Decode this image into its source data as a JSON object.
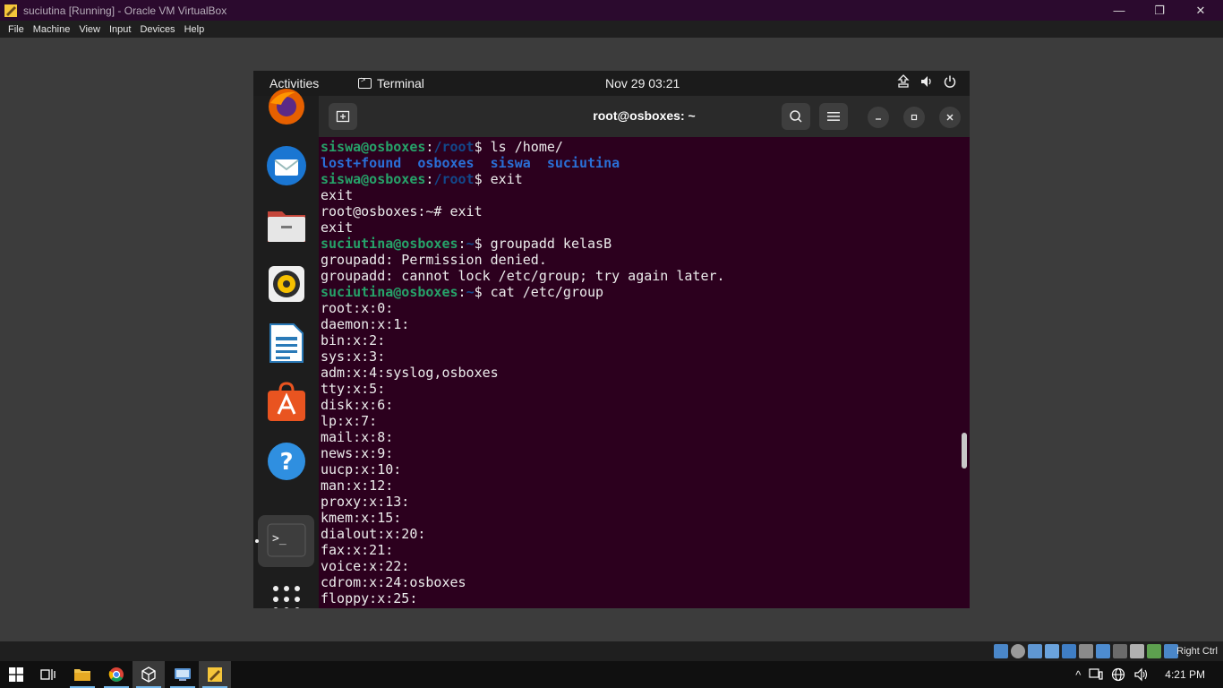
{
  "window": {
    "title": "suciutina [Running] - Oracle VM VirtualBox",
    "minimize_glyph": "—",
    "restore_glyph": "❐",
    "close_glyph": "✕"
  },
  "menubar": {
    "items": [
      "File",
      "Machine",
      "View",
      "Input",
      "Devices",
      "Help"
    ]
  },
  "guest_topbar": {
    "activities": "Activities",
    "app_name": "Terminal",
    "clock": "Nov 29  03:21"
  },
  "terminal": {
    "title": "root@osboxes: ~",
    "lines": [
      [
        {
          "t": "siswa@osboxes",
          "c": "user"
        },
        {
          "t": ":",
          "c": ""
        },
        {
          "t": "/root",
          "c": "path"
        },
        {
          "t": "$ ls /home/",
          "c": ""
        }
      ],
      [
        {
          "t": "lost+found  osboxes  siswa  suciutina",
          "c": "dir"
        }
      ],
      [
        {
          "t": "siswa@osboxes",
          "c": "user"
        },
        {
          "t": ":",
          "c": ""
        },
        {
          "t": "/root",
          "c": "path"
        },
        {
          "t": "$ exit",
          "c": ""
        }
      ],
      [
        {
          "t": "exit",
          "c": ""
        }
      ],
      [
        {
          "t": "root@osboxes:~# exit",
          "c": ""
        }
      ],
      [
        {
          "t": "exit",
          "c": ""
        }
      ],
      [
        {
          "t": "suciutina@osboxes",
          "c": "user"
        },
        {
          "t": ":",
          "c": ""
        },
        {
          "t": "~",
          "c": "path"
        },
        {
          "t": "$ groupadd kelasB",
          "c": ""
        }
      ],
      [
        {
          "t": "groupadd: Permission denied.",
          "c": ""
        }
      ],
      [
        {
          "t": "groupadd: cannot lock /etc/group; try again later.",
          "c": ""
        }
      ],
      [
        {
          "t": "suciutina@osboxes",
          "c": "user"
        },
        {
          "t": ":",
          "c": ""
        },
        {
          "t": "~",
          "c": "path"
        },
        {
          "t": "$ cat /etc/group",
          "c": ""
        }
      ],
      [
        {
          "t": "root:x:0:",
          "c": ""
        }
      ],
      [
        {
          "t": "daemon:x:1:",
          "c": ""
        }
      ],
      [
        {
          "t": "bin:x:2:",
          "c": ""
        }
      ],
      [
        {
          "t": "sys:x:3:",
          "c": ""
        }
      ],
      [
        {
          "t": "adm:x:4:syslog,osboxes",
          "c": ""
        }
      ],
      [
        {
          "t": "tty:x:5:",
          "c": ""
        }
      ],
      [
        {
          "t": "disk:x:6:",
          "c": ""
        }
      ],
      [
        {
          "t": "lp:x:7:",
          "c": ""
        }
      ],
      [
        {
          "t": "mail:x:8:",
          "c": ""
        }
      ],
      [
        {
          "t": "news:x:9:",
          "c": ""
        }
      ],
      [
        {
          "t": "uucp:x:10:",
          "c": ""
        }
      ],
      [
        {
          "t": "man:x:12:",
          "c": ""
        }
      ],
      [
        {
          "t": "proxy:x:13:",
          "c": ""
        }
      ],
      [
        {
          "t": "kmem:x:15:",
          "c": ""
        }
      ],
      [
        {
          "t": "dialout:x:20:",
          "c": ""
        }
      ],
      [
        {
          "t": "fax:x:21:",
          "c": ""
        }
      ],
      [
        {
          "t": "voice:x:22:",
          "c": ""
        }
      ],
      [
        {
          "t": "cdrom:x:24:osboxes",
          "c": ""
        }
      ],
      [
        {
          "t": "floppy:x:25:",
          "c": ""
        }
      ]
    ]
  },
  "dock": {
    "apps": [
      "firefox-icon",
      "thunderbird-icon",
      "files-icon",
      "rhythmbox-icon",
      "libreoffice-writer-icon",
      "software-center-icon",
      "help-icon",
      "terminal-icon",
      "show-apps-icon"
    ],
    "help_glyph": "?",
    "terminal_glyph": ">_"
  },
  "vbox_status": {
    "host_key": "Right Ctrl"
  },
  "taskbar": {
    "time": "4:21 PM",
    "tray_up_glyph": "^"
  },
  "colors": {
    "terminal_bg": "#2c001e",
    "prompt_user": "#26a269",
    "prompt_path": "#12488b",
    "titlebar": "#2b0a2e"
  }
}
